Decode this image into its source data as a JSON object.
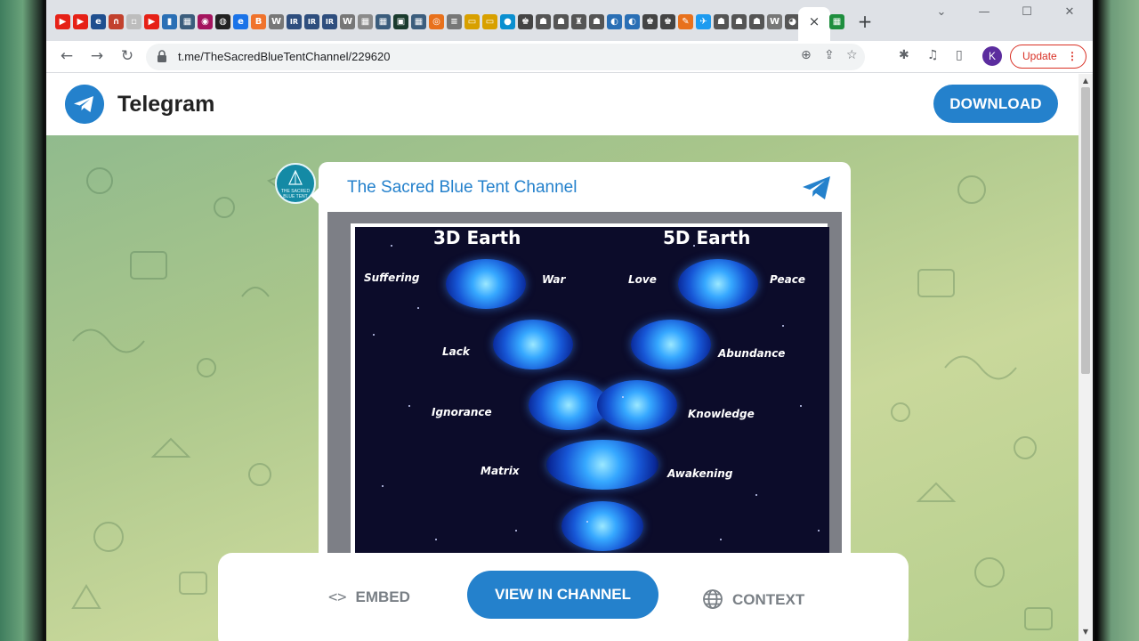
{
  "browser": {
    "tab_close_glyph": "×",
    "new_tab_glyph": "+",
    "url": "t.me/TheSacredBlueTentChannel/229620",
    "profile_initial": "K",
    "update_label": "Update",
    "window_controls": {
      "collapse": "⌄",
      "minimize": "—",
      "maximize": "☐",
      "close": "✕"
    },
    "favicons": [
      {
        "icon": "youtube-icon",
        "color": "#e62117",
        "glyph": "▶"
      },
      {
        "icon": "youtube-icon",
        "color": "#e62117",
        "glyph": "▶"
      },
      {
        "icon": "site-icon",
        "color": "#1f4f8f",
        "glyph": "e"
      },
      {
        "icon": "site-icon",
        "color": "#c2412d",
        "glyph": "∩"
      },
      {
        "icon": "page-icon",
        "color": "#bdbdbd",
        "glyph": "▫"
      },
      {
        "icon": "youtube-icon",
        "color": "#e62117",
        "glyph": "▶"
      },
      {
        "icon": "bookmark-icon",
        "color": "#2a6fb5",
        "glyph": "▮"
      },
      {
        "icon": "site-icon",
        "color": "#3b5d7d",
        "glyph": "▦"
      },
      {
        "icon": "site-icon",
        "color": "#a4145e",
        "glyph": "◉"
      },
      {
        "icon": "site-icon",
        "color": "#222222",
        "glyph": "◍"
      },
      {
        "icon": "site-icon",
        "color": "#1a73e8",
        "glyph": "e"
      },
      {
        "icon": "site-icon",
        "color": "#f0732c",
        "glyph": "B"
      },
      {
        "icon": "wikipedia-icon",
        "color": "#777777",
        "glyph": "W"
      },
      {
        "icon": "site-icon",
        "color": "#2e4e7e",
        "glyph": "IR"
      },
      {
        "icon": "site-icon",
        "color": "#2e4e7e",
        "glyph": "IR"
      },
      {
        "icon": "site-icon",
        "color": "#2e4e7e",
        "glyph": "IR"
      },
      {
        "icon": "wikipedia-icon",
        "color": "#777777",
        "glyph": "W"
      },
      {
        "icon": "site-icon",
        "color": "#8a8a8a",
        "glyph": "▦"
      },
      {
        "icon": "site-icon",
        "color": "#3b5d7d",
        "glyph": "▦"
      },
      {
        "icon": "site-icon",
        "color": "#1a3b2e",
        "glyph": "▣"
      },
      {
        "icon": "site-icon",
        "color": "#3b5d7d",
        "glyph": "▦"
      },
      {
        "icon": "site-icon",
        "color": "#e8711c",
        "glyph": "◎"
      },
      {
        "icon": "site-icon",
        "color": "#777777",
        "glyph": "≡"
      },
      {
        "icon": "site-icon",
        "color": "#d8a000",
        "glyph": "▭"
      },
      {
        "icon": "site-icon",
        "color": "#d8a000",
        "glyph": "▭"
      },
      {
        "icon": "site-icon",
        "color": "#0a8fd0",
        "glyph": "●"
      },
      {
        "icon": "chess-icon",
        "color": "#444444",
        "glyph": "♚"
      },
      {
        "icon": "site-icon",
        "color": "#555555",
        "glyph": "☗"
      },
      {
        "icon": "site-icon",
        "color": "#555555",
        "glyph": "☗"
      },
      {
        "icon": "site-icon",
        "color": "#555555",
        "glyph": "♜"
      },
      {
        "icon": "site-icon",
        "color": "#555555",
        "glyph": "☗"
      },
      {
        "icon": "site-icon",
        "color": "#2a6fb5",
        "glyph": "◐"
      },
      {
        "icon": "site-icon",
        "color": "#2a6fb5",
        "glyph": "◐"
      },
      {
        "icon": "chess-icon",
        "color": "#444444",
        "glyph": "♚"
      },
      {
        "icon": "chess-icon",
        "color": "#444444",
        "glyph": "♚"
      },
      {
        "icon": "site-icon",
        "color": "#e8711c",
        "glyph": "✎"
      },
      {
        "icon": "twitter-icon",
        "color": "#1d9bf0",
        "glyph": "✈"
      },
      {
        "icon": "site-icon",
        "color": "#555555",
        "glyph": "☗"
      },
      {
        "icon": "site-icon",
        "color": "#555555",
        "glyph": "☗"
      },
      {
        "icon": "site-icon",
        "color": "#555555",
        "glyph": "☗"
      },
      {
        "icon": "wikipedia-icon",
        "color": "#777777",
        "glyph": "W"
      },
      {
        "icon": "site-icon",
        "color": "#555555",
        "glyph": "◕"
      }
    ],
    "extra_tab_favicon": {
      "icon": "sheets-icon",
      "color": "#1e8e3e",
      "glyph": "▦"
    },
    "toolbar_icons": {
      "back": "←",
      "forward": "→",
      "reload": "↻",
      "zoom": "⊕",
      "share": "⇪",
      "star": "☆",
      "extensions": "✱",
      "media": "♫",
      "sidepanel": "▯"
    }
  },
  "telegram": {
    "brand_name": "Telegram",
    "download_label": "DOWNLOAD",
    "brand_color": "#2481cc",
    "post": {
      "channel_name": "The Sacred Blue Tent Channel",
      "avatar_text": "THE SACRED BLUE TENT",
      "image": {
        "title_left": "3D Earth",
        "title_right": "5D Earth",
        "labels_left": [
          "Suffering",
          "Lack",
          "Ignorance",
          "Matrix"
        ],
        "labels_right": [
          "Peace",
          "Abundance",
          "Knowledge",
          "Awakening"
        ],
        "labels_top_middle": [
          "War",
          "Love"
        ]
      }
    },
    "actions": {
      "embed_label": "EMBED",
      "embed_glyph": "<>",
      "view_label": "VIEW IN CHANNEL",
      "context_label": "CONTEXT"
    }
  }
}
